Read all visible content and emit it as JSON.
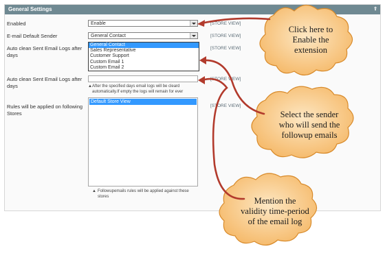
{
  "panel": {
    "title": "General Settings"
  },
  "rows": {
    "enabled": {
      "label": "Enabled",
      "value": "Enable",
      "scope": "[STORE VIEW]"
    },
    "sender": {
      "label": "E-mail Default Sender",
      "value": "General Contact",
      "scope": "[STORE VIEW]"
    },
    "clean_sent": {
      "label": "Auto clean Sent Email Logs after days",
      "scope": "[STORE VIEW]"
    },
    "clean_logs": {
      "label": "Auto clean Sent Email Logs after days",
      "scope": "[STORE VIEW]",
      "note": "After the specified days email logs will be cleard automatically.If empty the logs will remain for ever"
    },
    "stores": {
      "label": "Rules will be applied on following Stores",
      "scope": "[STORE VIEW]",
      "option": "Default Store View",
      "note": "Followupemails rules will be applied against these stores"
    }
  },
  "sender_options": [
    "General Contact",
    "Sales Representative",
    "Customer Support",
    "Custom Email 1",
    "Custom Email 2"
  ],
  "callouts": {
    "enable": "Click here to Enable the extension",
    "sender": "Select the sender who will send the followup emails",
    "validity": "Mention the validity time-period of the email log"
  },
  "colors": {
    "header": "#6f8992",
    "cloud": "#f8c982",
    "cloud_border": "#d88a2a",
    "arrow": "#b23a2c",
    "highlight": "#3399ff"
  }
}
